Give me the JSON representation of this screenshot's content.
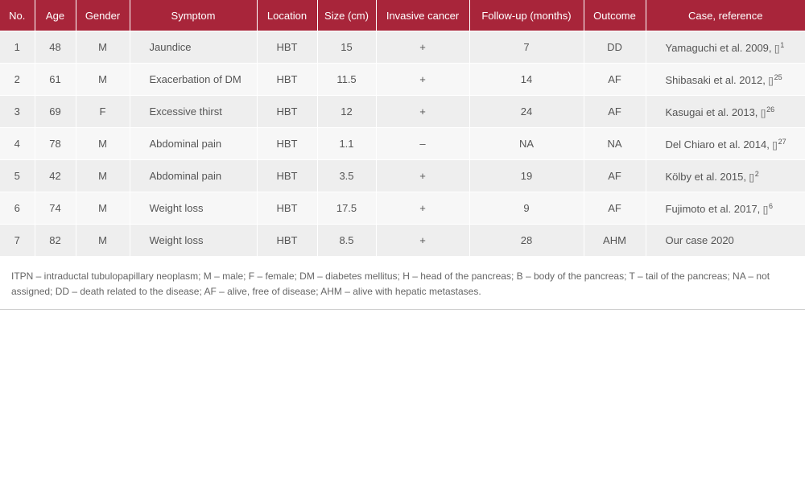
{
  "table": {
    "headers": [
      "No.",
      "Age",
      "Gender",
      "Symptom",
      "Location",
      "Size (cm)",
      "Invasive cancer",
      "Follow-up (months)",
      "Outcome",
      "Case, reference"
    ],
    "rows": [
      {
        "no": "1",
        "age": "48",
        "gender": "M",
        "symptom": "Jaundice",
        "location": "HBT",
        "size": "15",
        "invasive": "+",
        "followup": "7",
        "outcome": "DD",
        "reference": "Yamaguchi et al. 2009,",
        "ref_mark": "[]",
        "ref_num": "1"
      },
      {
        "no": "2",
        "age": "61",
        "gender": "M",
        "symptom": "Exacerbation of DM",
        "location": "HBT",
        "size": "11.5",
        "invasive": "+",
        "followup": "14",
        "outcome": "AF",
        "reference": "Shibasaki et al. 2012,",
        "ref_mark": "[]",
        "ref_num": "25"
      },
      {
        "no": "3",
        "age": "69",
        "gender": "F",
        "symptom": "Excessive thirst",
        "location": "HBT",
        "size": "12",
        "invasive": "+",
        "followup": "24",
        "outcome": "AF",
        "reference": "Kasugai et al. 2013,",
        "ref_mark": "[]",
        "ref_num": "26"
      },
      {
        "no": "4",
        "age": "78",
        "gender": "M",
        "symptom": "Abdominal pain",
        "location": "HBT",
        "size": "1.1",
        "invasive": "–",
        "followup": "NA",
        "outcome": "NA",
        "reference": "Del Chiaro et al. 2014,",
        "ref_mark": "[]",
        "ref_num": "27"
      },
      {
        "no": "5",
        "age": "42",
        "gender": "M",
        "symptom": "Abdominal pain",
        "location": "HBT",
        "size": "3.5",
        "invasive": "+",
        "followup": "19",
        "outcome": "AF",
        "reference": "Kölby et al. 2015,",
        "ref_mark": "[]",
        "ref_num": "2"
      },
      {
        "no": "6",
        "age": "74",
        "gender": "M",
        "symptom": "Weight loss",
        "location": "HBT",
        "size": "17.5",
        "invasive": "+",
        "followup": "9",
        "outcome": "AF",
        "reference": "Fujimoto et al. 2017,",
        "ref_mark": "[]",
        "ref_num": "6"
      },
      {
        "no": "7",
        "age": "82",
        "gender": "M",
        "symptom": "Weight loss",
        "location": "HBT",
        "size": "8.5",
        "invasive": "+",
        "followup": "28",
        "outcome": "AHM",
        "reference": "Our case 2020",
        "ref_mark": "",
        "ref_num": ""
      }
    ]
  },
  "footnote": "ITPN – intraductal tubulopapillary neoplasm; M – male; F – female; DM – diabetes mellitus; H – head of the pancreas; B – body of the pancreas; T – tail of the pancreas; NA – not assigned; DD – death related to the disease; AF – alive, free of disease; AHM – alive with hepatic metastases.",
  "colors": {
    "header_bg": "#a8253a",
    "header_text": "#ffffff",
    "row_odd": "#eeeeee",
    "row_even": "#f7f7f7"
  }
}
